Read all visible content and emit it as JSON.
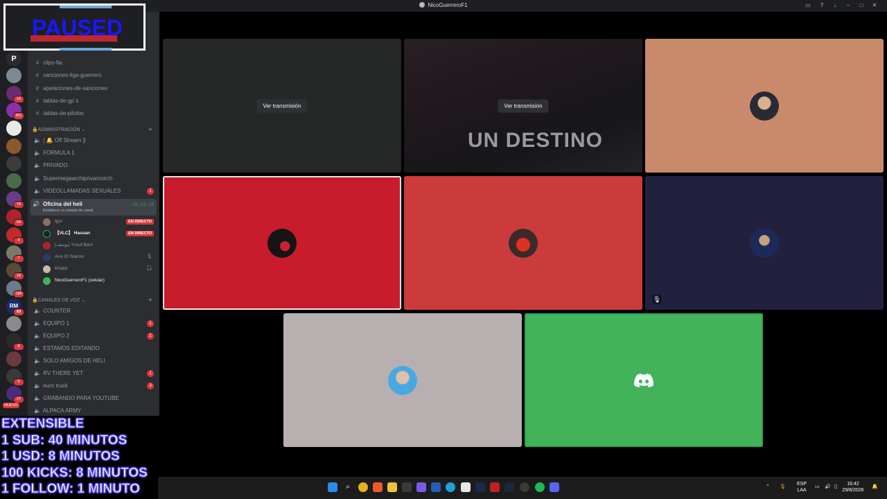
{
  "window": {
    "title": "NicoGuerreroF1"
  },
  "overlay": {
    "paused": "PAUSED",
    "promo_lines": [
      "EXTENSIBLE",
      "1 SUB: 40 MINUTOS",
      "1 USD: 8 MINUTOS",
      "100 KICKS: 8 MINUTOS",
      "1 FOLLOW: 1 MINUTO"
    ]
  },
  "servers": {
    "badges": [
      "19",
      "10",
      "451",
      "76",
      "64",
      "4",
      "7",
      "16",
      "186",
      "83",
      "8",
      "9",
      "27"
    ],
    "nuevo": "NUEVO"
  },
  "sidebar": {
    "text_channels": [
      "clips-fia",
      "sanciones-liga-guerrero",
      "apelaciones-de-sanciones",
      "tablas-de-gp´s",
      "tablas-de-pilotos"
    ],
    "category_admin": "ADMINISTRACIÓN",
    "admin_channels": [
      {
        "label": "| 🔔 Off Stream ]|",
        "badge": ""
      },
      {
        "label": "FORMULA 1",
        "badge": ""
      },
      {
        "label": "PRIVADO",
        "badge": ""
      },
      {
        "label": "Supermegaarchiprivamoirch",
        "badge": ""
      },
      {
        "label": "VIDEOLLAMADAS SEXUALES",
        "badge": "1"
      }
    ],
    "active_channel": {
      "name": "Oficina del heli",
      "status": "Establece un estado de canal",
      "timer": "28:13:16"
    },
    "voice_users": [
      {
        "name": "Igor",
        "live": "EN DIRECTO"
      },
      {
        "name": "【VLC】 Hassan",
        "live": "EN DIRECTO"
      },
      {
        "name": "(يوسف) Yusuf Barri",
        "live": ""
      },
      {
        "name": "Aviv El Warrior",
        "live": ""
      },
      {
        "name": "Khalid",
        "live": ""
      },
      {
        "name": "NicoGuerreroF1 (celular)",
        "live": ""
      }
    ],
    "category_voice": "CANALES DE VOZ",
    "voice_channels": [
      {
        "label": "COUNTER",
        "badge": ""
      },
      {
        "label": "EQUIPO 1",
        "badge": "1"
      },
      {
        "label": "EQUIPO 2",
        "badge": "1"
      },
      {
        "label": "ESTAMOS EDITANDO",
        "badge": ""
      },
      {
        "label": "SOLO AMIGOS DE HELI",
        "badge": ""
      },
      {
        "label": "RV THERE YET",
        "badge": "1"
      },
      {
        "label": "euro truck",
        "badge": "3"
      },
      {
        "label": "GRABANDO PARA YOUTUBE",
        "badge": ""
      },
      {
        "label": "ALPACA ARMY",
        "badge": ""
      }
    ]
  },
  "grid": {
    "watch_label": "Ver transmisión",
    "stream_caption": "UN DESTINO",
    "colors": {
      "stream1": "#252827",
      "tile_salmon": "#c98a6c",
      "tile_red1": "#c81b2c",
      "tile_red2": "#cc3b3c",
      "tile_navy": "#21213f",
      "tile_gray": "#b8b0b0",
      "tile_green": "#43b35a"
    }
  },
  "taskbar": {
    "lang1": "ESP",
    "lang2": "LAA",
    "time": "16:42",
    "date": "29/8/2026"
  }
}
